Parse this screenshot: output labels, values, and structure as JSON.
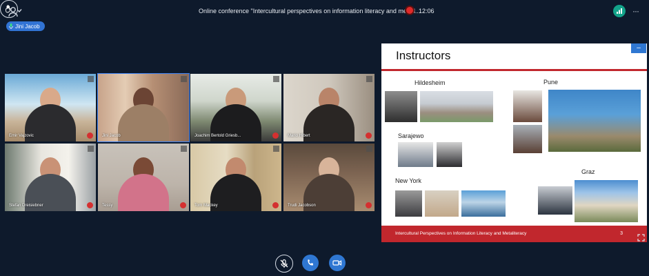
{
  "header": {
    "meeting_title": "Online conference \"Intercultural perspectives on information literacy and meta l...",
    "timer": "12:06"
  },
  "active_speaker": "Jini Jacob",
  "participants": [
    {
      "name": "Emir Vajzovic"
    },
    {
      "name": "Jini Jacob"
    },
    {
      "name": "Joachim Bertold Griesb..."
    },
    {
      "name": "Mario Hibert"
    },
    {
      "name": "Stefan Dreisiebner"
    },
    {
      "name": "Tessy"
    },
    {
      "name": "Tom Mackey"
    },
    {
      "name": "Trudi Jacobson"
    }
  ],
  "slide": {
    "title": "Instructors",
    "cities": [
      "Hildesheim",
      "Pune",
      "Sarajewo",
      "New York",
      "Graz"
    ],
    "footer": "Intercultural Perspectives on Information Literacy and Metaliteracy",
    "page_number": "3",
    "minimize_label": "–"
  },
  "colors": {
    "background": "#0e1a2c",
    "accent_blue": "#3173d4",
    "slide_red": "#c1272d",
    "record_red": "#e02a2a",
    "signal_green": "#13a38a"
  },
  "icons": [
    "people-icon",
    "microphone-icon",
    "record-icon",
    "signal-icon",
    "more-icon",
    "expand-icon",
    "muted-microphone-icon",
    "phone-icon",
    "video-camera-icon",
    "raise-hand-icon"
  ]
}
